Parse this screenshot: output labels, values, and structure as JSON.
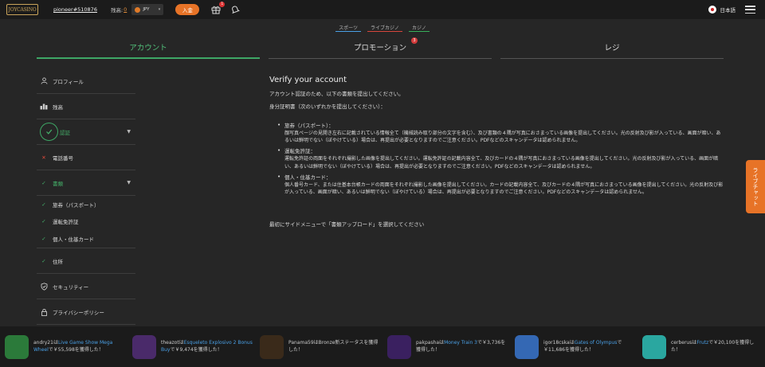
{
  "header": {
    "logo_text": "JOYCASINO",
    "username": "pioneer#510876",
    "balance_label": "残高:",
    "balance_value": "0",
    "currency": "JPY",
    "deposit_label": "入金",
    "gift_badge": "1",
    "language": "日本語"
  },
  "subnav": {
    "items": [
      "スポーツ",
      "ライブカジノ",
      "カジノ"
    ]
  },
  "tabs": {
    "account": "アカウント",
    "promotion": "プロモーション",
    "promotion_badge": "3",
    "cashier": "レジ"
  },
  "sidebar": {
    "profile": "プロフィール",
    "balance": "残高",
    "verification": "認証",
    "phone": "電話番号",
    "documents": "書類",
    "passport": "旅券（パスポート）",
    "license": "運転免許証",
    "personal": "個人・住基カード",
    "address": "住所",
    "security": "セキュリティー",
    "privacy": "プライバシーポリシー"
  },
  "content": {
    "title": "Verify your account",
    "intro": "アカウント認証のため、以下の書類を提出してください。",
    "id_docs": "身分証明書（次のいずれかを提出してください）：",
    "items": [
      {
        "title": "旅券（パスポート）：",
        "desc": "顔写真ページの見開き左右に記載されている情報全て（機械読み取り部分の文字を含む）、及び書類の４隅が写真におさまっている画像を提出してください。光の反射及び影が入っている、画面が暗い、あるいは鮮明でない（ぼやけている）場合は、再提出が必要となりますのでご注意ください。PDFなどのスキャンデータは認められません。"
      },
      {
        "title": "運転免許証：",
        "desc": "運転免許証の両面をそれぞれ撮影した画像を提出してください。運転免許証の記載内容全て、及びカードの４隅が写真におさまっている画像を提出してください。光の反射及び影が入っている、画面が暗い、あるいは鮮明でない（ぼやけている）場合は、再提出が必要となりますのでご注意ください。PDFなどのスキャンデータは認められません。"
      },
      {
        "title": "個人・住基カード：",
        "desc": "個人番号カード、または住基本台帳カードの両面をそれぞれ撮影した画像を提出してください。カードの記載内容全て、及びカードの４隅が写真におさまっている画像を提出してください。光の反射及び影が入っている、画面が暗い、あるいは鮮明でない（ぼやけている）場合は、再提出が必要となりますのでご注意ください。PDFなどのスキャンデータは認められません。"
      }
    ],
    "final": "最初にサイドメニューで「書類アップロード」を選択してください"
  },
  "livechat": "ライブチャット",
  "winners": [
    {
      "pre": "andry21は",
      "game": "Live Game Show Mega Wheel",
      "post": "で￥55,598を獲得した！",
      "color": "#2b7a3a"
    },
    {
      "pre": "theazotは",
      "game": "Esqueleto Explosivo 2 Bonus Buy",
      "post": "で￥9,474を獲得した！",
      "color": "#4a2a6a"
    },
    {
      "pre": "Panama59はBronze新ステータスを獲得した！",
      "game": "",
      "post": "",
      "color": "#3a2a1a"
    },
    {
      "pre": "pakpashaは",
      "game": "Money Train 3",
      "post": "で￥3,736を獲得した！",
      "color": "#3a2060"
    },
    {
      "pre": "igor18cskaは",
      "game": "Gates of Olympus",
      "post": "で￥11,686を獲得した！",
      "color": "#3468b4"
    },
    {
      "pre": "cerberusは",
      "game": "Frutz",
      "post": "で￥20,100を獲得した！",
      "color": "#2aa7a0"
    }
  ]
}
